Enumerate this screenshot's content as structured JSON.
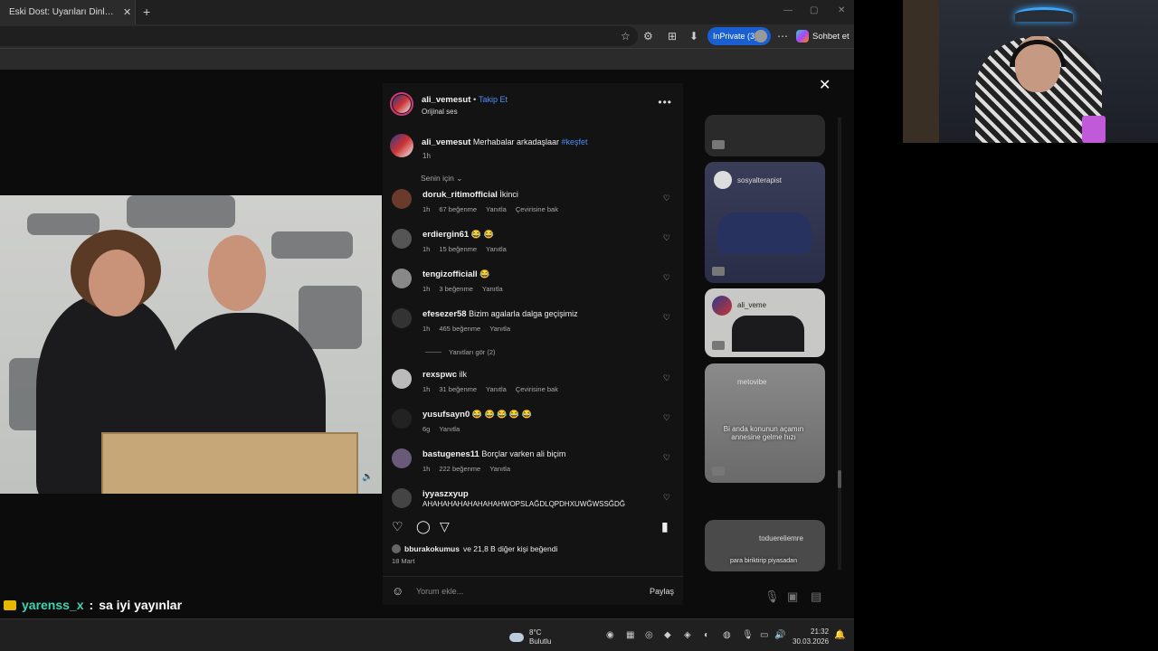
{
  "browser": {
    "tab_title": "Eski Dost: Uyarıları Dinlememek N",
    "tab_close": "✕",
    "new_tab": "+",
    "inprivate": "InPrivate (3)",
    "chat_label": "Sohbet et"
  },
  "post": {
    "author": "ali_vemesut",
    "follow": "Takip Et",
    "audio": "Orijinal ses",
    "caption_user": "ali_vemesut",
    "caption_text": "Merhabalar arkadaşlaar",
    "caption_tag": "#keşfet",
    "caption_time": "1h",
    "sort_label": "Senin için",
    "comments": [
      {
        "user": "doruk_ritimofficial",
        "text": "İkinci",
        "time": "1h",
        "likes": "67 beğenme",
        "reply": "Yanıtla",
        "translate": "Çevirisine bak"
      },
      {
        "user": "erdiergin61",
        "text": "😂 😂",
        "time": "1h",
        "likes": "15 beğenme",
        "reply": "Yanıtla",
        "translate": ""
      },
      {
        "user": "tengizofficiall",
        "text": "😂",
        "time": "1h",
        "likes": "3 beğenme",
        "reply": "Yanıtla",
        "translate": ""
      },
      {
        "user": "efesezer58",
        "text": "Bizim agalarla dalga geçişimiz",
        "time": "1h",
        "likes": "465 beğenme",
        "reply": "Yanıtla",
        "translate": ""
      },
      {
        "user": "rexspwc",
        "text": "ilk",
        "time": "1h",
        "likes": "31 beğenme",
        "reply": "Yanıtla",
        "translate": "Çevirisine bak"
      },
      {
        "user": "yusufsayn0",
        "text": "😂 😂 😂 😂 😂",
        "time": "6g",
        "likes": "",
        "reply": "Yanıtla",
        "translate": ""
      },
      {
        "user": "bastugenes11",
        "text": "Borçlar varken ali biçim",
        "time": "1h",
        "likes": "222 beğenme",
        "reply": "Yanıtla",
        "translate": ""
      },
      {
        "user": "iyyaszxyup",
        "text": "AHAHAHAHAHAHAHAHWOPSLAĞDLQPDHXUWĞWSSĞDĞ",
        "time": "",
        "likes": "",
        "reply": "",
        "translate": ""
      }
    ],
    "view_replies": "Yanıtları gör (2)",
    "liked_by_user": "bburakokumus",
    "liked_by_rest": "ve 21,8 B diğer kişi beğendi",
    "date": "18 Mart",
    "comment_placeholder": "Yorum ekle...",
    "share": "Paylaş"
  },
  "sidebar_thumbs": [
    {
      "name": "",
      "caption": ""
    },
    {
      "name": "sosyalterapist",
      "caption": ""
    },
    {
      "name": "ali_veme",
      "caption": ""
    },
    {
      "name": "metovibe",
      "caption": "Bi anda konunun açamın annesine gelme hızı"
    },
    {
      "name": "toduereliemre",
      "caption": "para biriktirip piyasadan"
    }
  ],
  "chat": {
    "user": "yarenss_x",
    "sep": ":",
    "message": "sa iyi yayınlar"
  },
  "taskbar": {
    "temp": "8°C",
    "weather": "Bulutlu",
    "time": "21:32",
    "date": "30.03.2026"
  },
  "colors": {
    "accent": "#1a5fd0",
    "link": "#4f8ef7",
    "chat_user": "#3fd4b0"
  }
}
